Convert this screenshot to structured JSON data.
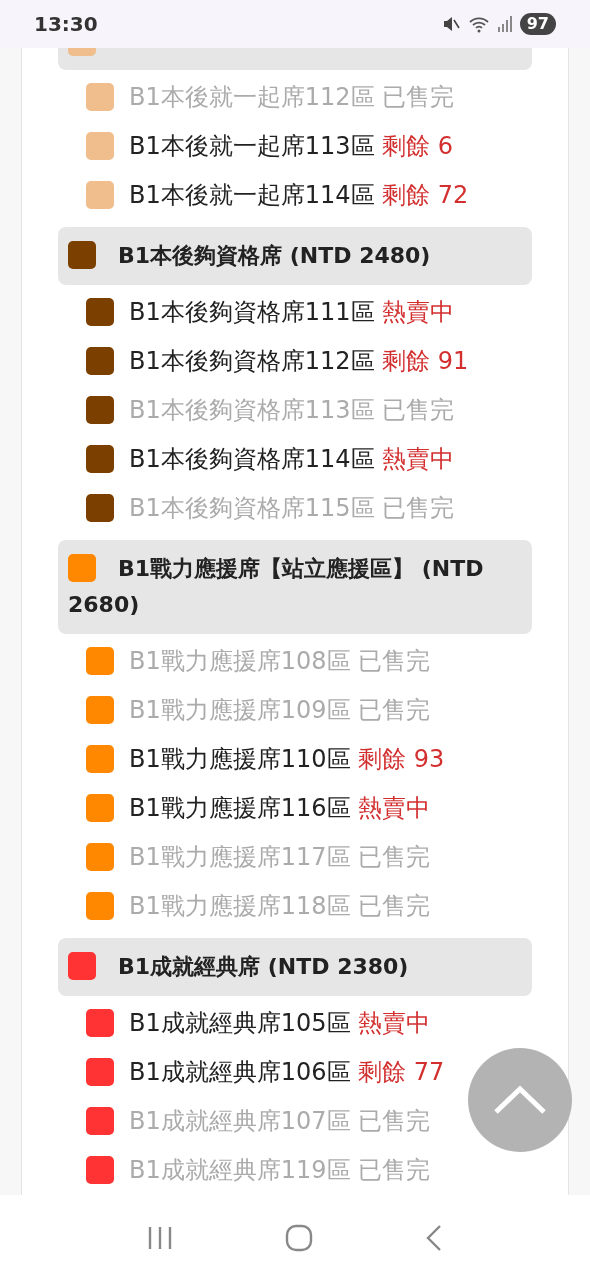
{
  "status_bar": {
    "time": "13:30",
    "battery": "97"
  },
  "groups": [
    {
      "color": "#f0bd8c",
      "items": [
        {
          "name": "B1本後就一起席112區",
          "status": "已售完",
          "available": false
        },
        {
          "name": "B1本後就一起席113區",
          "status": "剩餘 6",
          "available": true
        },
        {
          "name": "B1本後就一起席114區",
          "status": "剩餘 72",
          "available": true
        }
      ]
    },
    {
      "title": "B1本後夠資格席 (NTD 2480)",
      "color": "#7b3f00",
      "items": [
        {
          "name": "B1本後夠資格席111區",
          "status": "熱賣中",
          "available": true
        },
        {
          "name": "B1本後夠資格席112區",
          "status": "剩餘 91",
          "available": true
        },
        {
          "name": "B1本後夠資格席113區",
          "status": "已售完",
          "available": false
        },
        {
          "name": "B1本後夠資格席114區",
          "status": "熱賣中",
          "available": true
        },
        {
          "name": "B1本後夠資格席115區",
          "status": "已售完",
          "available": false
        }
      ]
    },
    {
      "title": "B1戰力應援席【站立應援區】 (NTD 2680)",
      "color": "#ff8800",
      "items": [
        {
          "name": "B1戰力應援席108區",
          "status": "已售完",
          "available": false
        },
        {
          "name": "B1戰力應援席109區",
          "status": "已售完",
          "available": false
        },
        {
          "name": "B1戰力應援席110區",
          "status": "剩餘 93",
          "available": true
        },
        {
          "name": "B1戰力應援席116區",
          "status": "熱賣中",
          "available": true
        },
        {
          "name": "B1戰力應援席117區",
          "status": "已售完",
          "available": false
        },
        {
          "name": "B1戰力應援席118區",
          "status": "已售完",
          "available": false
        }
      ]
    },
    {
      "title": "B1成就經典席 (NTD 2380)",
      "color": "#ff3333",
      "items": [
        {
          "name": "B1成就經典席105區",
          "status": "熱賣中",
          "available": true
        },
        {
          "name": "B1成就經典席106區",
          "status": "剩餘 77",
          "available": true
        },
        {
          "name": "B1成就經典席107區",
          "status": "已售完",
          "available": false
        },
        {
          "name": "B1成就經典席119區",
          "status": "已售完",
          "available": false
        }
      ]
    }
  ]
}
